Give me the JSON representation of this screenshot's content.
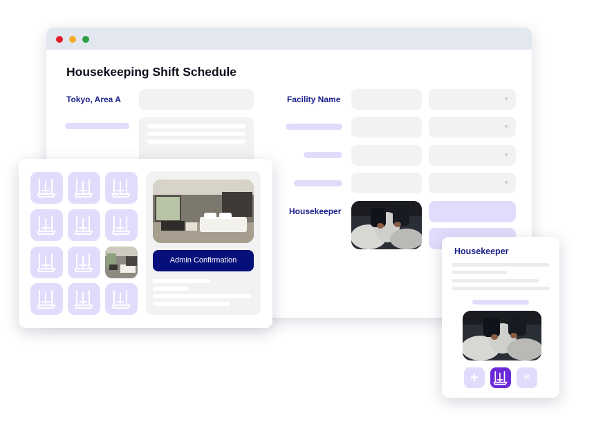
{
  "main_window": {
    "title": "Housekeeping Shift Schedule",
    "location_label": "Tokyo, Area A",
    "facility_label": "Facility Name",
    "housekeeper_label": "Housekeeper"
  },
  "image_grid_card": {
    "admin_button_label": "Admin Confirmation"
  },
  "mobile_card": {
    "title": "Housekeeper",
    "buttons": {
      "add": "+",
      "menu": "≡"
    }
  },
  "colors": {
    "accent_navy": "#07107a",
    "label_blue": "#1a1f8a",
    "lavender": "#e2dcfc",
    "purple_active": "#6c2bd9"
  }
}
